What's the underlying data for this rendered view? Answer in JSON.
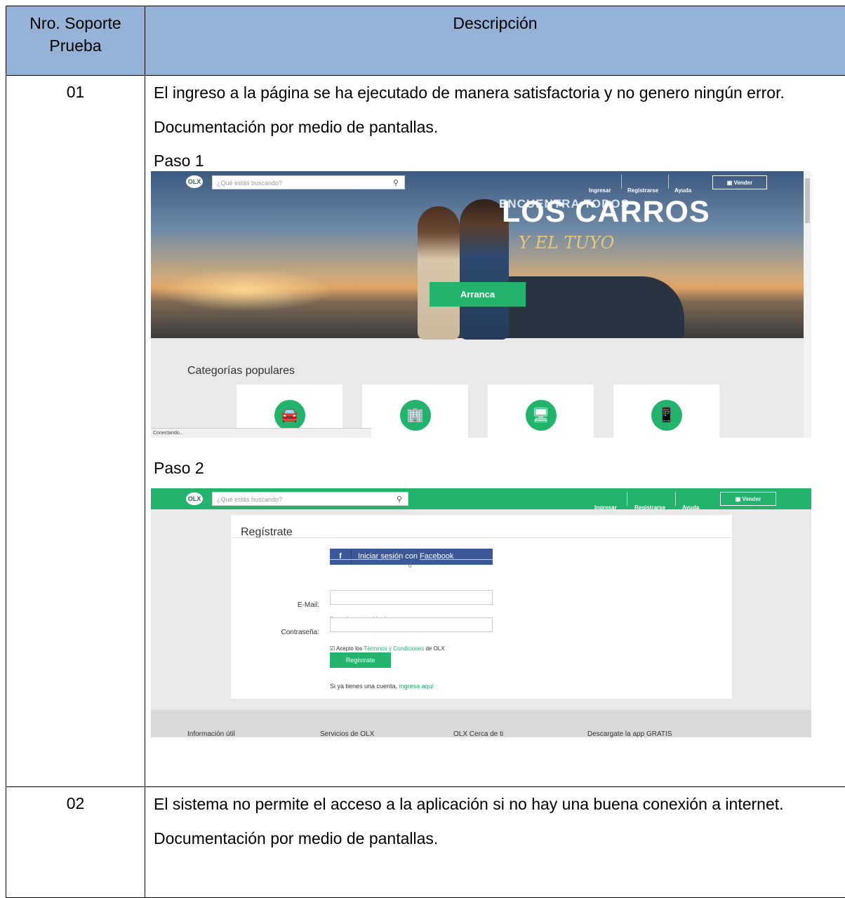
{
  "header": {
    "col1": "Nro. Soporte Prueba",
    "col2": "Descripción"
  },
  "rows": [
    {
      "num": "01",
      "text": "El ingreso a la página se ha ejecutado de manera satisfactoria y no genero ningún error.",
      "doc_note": "Documentación  por medio de pantallas.",
      "step1_label": "Paso 1",
      "step2_label": "Paso 2"
    },
    {
      "num": "02",
      "text": "El sistema no permite el acceso a la aplicación si no hay una buena conexión a internet.",
      "doc_note": "Documentación  por medio de pantallas."
    }
  ],
  "screenshot1": {
    "logo": "OLX",
    "search_placeholder": "¿Qué estás buscando?",
    "nav": {
      "login": "Ingresar",
      "register": "Registrarse",
      "help": "Ayuda",
      "sell": "Vender"
    },
    "hero_line1": "ENCUENTRA TODOS",
    "hero_line2": "LOS CARROS",
    "hero_line3": "Y EL TUYO",
    "cta": "Arranca",
    "categories_title": "Categorías populares",
    "category_icons": [
      "car-icon",
      "building-icon",
      "monitor-icon",
      "phone-icon"
    ],
    "status_text": "Conectando...",
    "colors": {
      "accent": "#23b36c"
    }
  },
  "screenshot2": {
    "logo": "OLX",
    "search_placeholder": "¿Qué estás buscando?",
    "nav": {
      "login": "Ingresar",
      "register": "Registrarse",
      "help": "Ayuda",
      "sell": "Vender"
    },
    "title": "Regístrate",
    "facebook_button": "Iniciar sesión con Facebook",
    "or_text": "ó",
    "email_label": "E-Mail:",
    "email_hint": "Tu email no será publicado.",
    "password_label": "Contraseña:",
    "terms_prefix": "Acepto los",
    "terms_link": "Términos y Condiciones",
    "terms_suffix": "de OLX",
    "register_button": "Regístrate",
    "already_prefix": "Si ya tienes una cuenta,",
    "already_link": "ingresa aquí",
    "footer": [
      "Información útil",
      "Servicios de OLX",
      "OLX Cerca de ti",
      "Descargate la app GRATIS"
    ],
    "colors": {
      "accent": "#23b36c",
      "facebook": "#3b5998"
    }
  }
}
